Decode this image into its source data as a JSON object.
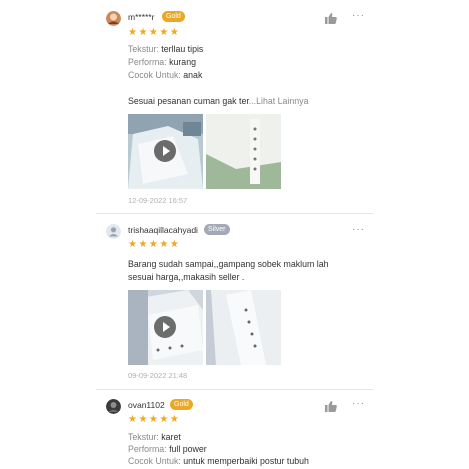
{
  "reviews": [
    {
      "username": "m*****r",
      "badge": "Gold",
      "stars": "★★★★★",
      "attributes": [
        {
          "label": "Tekstur:",
          "value": "terllau tipis"
        },
        {
          "label": "Performa:",
          "value": "kurang"
        },
        {
          "label": "Cocok Untuk:",
          "value": "anak"
        }
      ],
      "text": "Sesuai pesanan cuman gak ter",
      "more": "...Lihat Lainnya",
      "date": "12-09-2022 16:57"
    },
    {
      "username": "trishaaqillacahyadi",
      "badge": "Silver",
      "stars": "★★★★★",
      "text_line1": "Barang sudah sampai,,gampang sobek maklum lah",
      "text_line2": "sesuai harga,,makasih seller .",
      "date": "09-09-2022 21:48"
    },
    {
      "username": "ovan1102",
      "badge": "Gold",
      "stars": "★★★★★",
      "attributes": [
        {
          "label": "Tekstur:",
          "value": "karet"
        },
        {
          "label": "Performa:",
          "value": "full power"
        },
        {
          "label": "Cocok Untuk:",
          "value": "untuk memperbaiki postur tubuh"
        }
      ]
    }
  ],
  "icons": {
    "like": "thumbs-up-icon",
    "more": "more-options-icon",
    "play": "play-icon"
  },
  "more_glyph": "···",
  "colors": {
    "gold_badge": "#e9a825",
    "silver_badge": "#a3aab6",
    "star": "#f0a91c",
    "muted": "#8a8a8a"
  }
}
